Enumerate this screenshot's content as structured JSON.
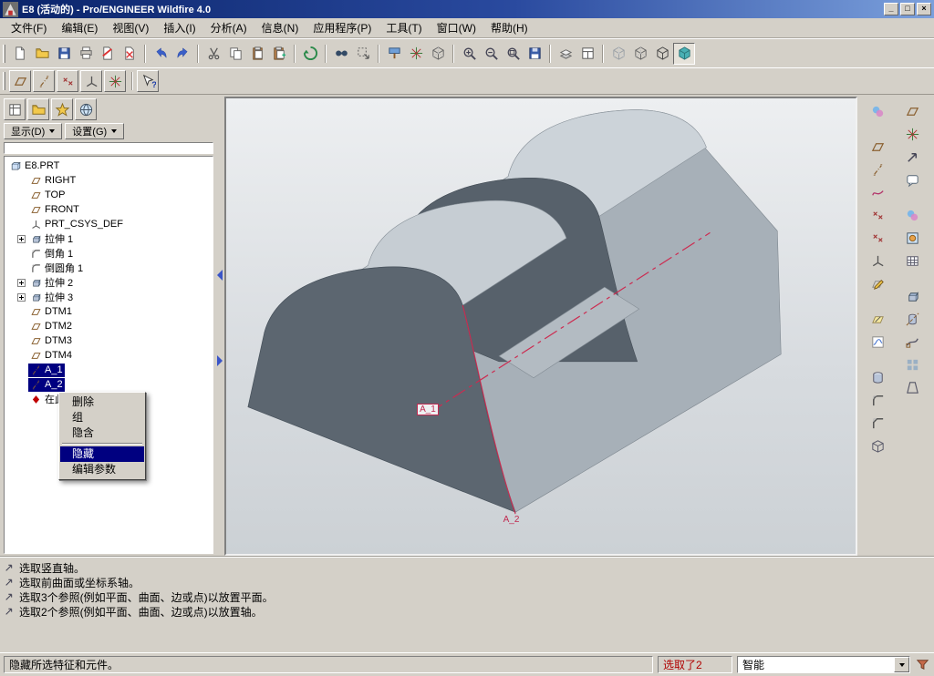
{
  "titlebar": {
    "title": "E8 (活动的) - Pro/ENGINEER Wildfire 4.0",
    "app_icon": "proe-app-icon",
    "buttons": [
      {
        "name": "minimize-button",
        "glyph": "_"
      },
      {
        "name": "restore-button",
        "glyph": "□"
      },
      {
        "name": "close-button",
        "glyph": "×"
      }
    ]
  },
  "menubar": {
    "items": [
      "文件(F)",
      "编辑(E)",
      "视图(V)",
      "插入(I)",
      "分析(A)",
      "信息(N)",
      "应用程序(P)",
      "工具(T)",
      "窗口(W)",
      "帮助(H)"
    ]
  },
  "toolbar_main": {
    "active_icon": "shaded-icon",
    "items": [
      "new-file-icon",
      "open-folder-icon",
      "save-icon",
      "print-icon",
      "erase-display-icon",
      "delete-old-versions-icon",
      "|",
      "undo-icon",
      "redo-icon",
      "|",
      "cut-icon",
      "copy-icon",
      "paste-icon",
      "paste-special-icon",
      "|",
      "regenerate-icon",
      "|",
      "find-icon",
      "select-box-icon",
      "|",
      "repaint-icon",
      "spin-center-icon",
      "orient-icon",
      "|",
      "zoom-in-icon",
      "zoom-out-icon",
      "refit-icon",
      "saved-views-icon",
      "|",
      "layers-icon",
      "view-manager-icon",
      "|",
      "wireframe-icon",
      "hidden-line-icon",
      "no-hidden-icon",
      "shaded-icon"
    ]
  },
  "toolbar_second": {
    "items": [
      "datum-plane-display-icon",
      "datum-axis-display-icon",
      "datum-point-display-icon",
      "datum-csys-display-icon",
      "spin-center-display-icon",
      "|",
      "context-help-icon"
    ]
  },
  "navigator": {
    "tabs": [
      "model-tree-tab-icon",
      "folder-tree-tab-icon",
      "favorites-tab-icon",
      "connections-tab-icon"
    ],
    "display_button": "显示(D)",
    "settings_button": "设置(G)",
    "tree": [
      {
        "label": "E8.PRT",
        "icon": "part-icon",
        "level": 0
      },
      {
        "label": "RIGHT",
        "icon": "datum-plane-icon",
        "level": 1
      },
      {
        "label": "TOP",
        "icon": "datum-plane-icon",
        "level": 1
      },
      {
        "label": "FRONT",
        "icon": "datum-plane-icon",
        "level": 1
      },
      {
        "label": "PRT_CSYS_DEF",
        "icon": "datum-csys-icon",
        "level": 1
      },
      {
        "label": "拉伸 1",
        "icon": "extrude-feature-icon",
        "level": 1,
        "expandable": true
      },
      {
        "label": "倒角 1",
        "icon": "chamfer-feature-icon",
        "level": 1
      },
      {
        "label": "倒圆角 1",
        "icon": "round-feature-icon",
        "level": 1
      },
      {
        "label": "拉伸 2",
        "icon": "extrude-feature-icon",
        "level": 1,
        "expandable": true
      },
      {
        "label": "拉伸 3",
        "icon": "extrude-feature-icon",
        "level": 1,
        "expandable": true
      },
      {
        "label": "DTM1",
        "icon": "datum-plane-icon",
        "level": 1
      },
      {
        "label": "DTM2",
        "icon": "datum-plane-icon",
        "level": 1
      },
      {
        "label": "DTM3",
        "icon": "datum-plane-icon",
        "level": 1
      },
      {
        "label": "DTM4",
        "icon": "datum-plane-icon",
        "level": 1
      },
      {
        "label": "A_1",
        "icon": "datum-axis-icon",
        "level": 1,
        "selected": true
      },
      {
        "label": "A_2",
        "icon": "datum-axis-icon",
        "level": 1,
        "selected": true
      },
      {
        "label": "在此插入",
        "icon": "insert-here-icon",
        "level": 1
      }
    ]
  },
  "context_menu": {
    "items": [
      {
        "label": "删除"
      },
      {
        "label": "组"
      },
      {
        "label": "隐含"
      },
      {
        "separator": true
      },
      {
        "label": "隐藏",
        "highlighted": true
      },
      {
        "label": "编辑参数"
      }
    ]
  },
  "viewport": {
    "axis_labels": [
      {
        "text": "A_1"
      },
      {
        "text": "A_2"
      }
    ],
    "accent_color": "#cc2b50"
  },
  "right_toolbar": {
    "col_a": [
      "style-tool-icon",
      "gap",
      "datum-plane-tool-icon",
      "datum-axis-tool-icon",
      "datum-curve-tool-icon",
      "datum-point-tool-icon",
      "offset-point-tool-icon",
      "datum-csys-tool-icon",
      "sketch-tool-icon",
      "gap",
      "annotation-tool-icon",
      "graph-tool-icon",
      "gap",
      "hole-tool-icon",
      "round-tool-icon",
      "chamfer-tool-icon",
      "shell-tool-icon"
    ],
    "col_b": [
      "view-plane-icon",
      "view-spin-icon",
      "view-arrow-icon",
      "note-tool-icon",
      "gap",
      "appearance-tool-icon",
      "render-tool-icon",
      "table-tool-icon",
      "gap",
      "extrude-tool-icon",
      "revolve-tool-icon",
      "sweep-tool-icon",
      "pattern-tool-icon",
      "draft-tool-icon"
    ]
  },
  "messages": {
    "lines": [
      "选取竖直轴。",
      "选取前曲面或坐标系轴。",
      "选取3个参照(例如平面、曲面、边或点)以放置平面。",
      "选取2个参照(例如平面、曲面、边或点)以放置轴。"
    ]
  },
  "statusbar": {
    "message": "隐藏所选特征和元件。",
    "selection_count": "选取了2",
    "selection_filter": "智能"
  }
}
